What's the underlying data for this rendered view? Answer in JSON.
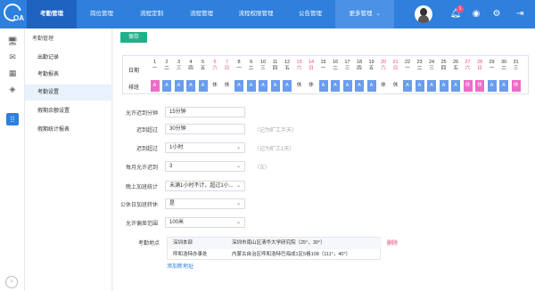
{
  "brand": {
    "logo_text": "OA"
  },
  "nav": {
    "items": [
      "考勤管理",
      "岗位管理",
      "流程定制",
      "流程管理",
      "流程权限管理",
      "公告管理"
    ],
    "more_label": "更多管理"
  },
  "topbar": {
    "notification_count": "1"
  },
  "sidebar": {
    "title": "考勤管理",
    "items": [
      "出勤记录",
      "考勤报表",
      "考勤设置",
      "假期余额设置",
      "假期统计报表"
    ]
  },
  "toolbar": {
    "save_label": "保存"
  },
  "calendar": {
    "date_label": "日期",
    "shift_label": "排班",
    "days": [
      {
        "n": "1",
        "w": "一",
        "s": "A",
        "we": false,
        "pink": true
      },
      {
        "n": "2",
        "w": "二",
        "s": "A",
        "we": false
      },
      {
        "n": "3",
        "w": "三",
        "s": "A",
        "we": false
      },
      {
        "n": "4",
        "w": "四",
        "s": "A",
        "we": false
      },
      {
        "n": "5",
        "w": "五",
        "s": "A",
        "we": false
      },
      {
        "n": "6",
        "w": "六",
        "s": "休",
        "we": true,
        "rest": true
      },
      {
        "n": "7",
        "w": "日",
        "s": "休",
        "we": true,
        "rest": true
      },
      {
        "n": "8",
        "w": "一",
        "s": "A",
        "we": false
      },
      {
        "n": "9",
        "w": "二",
        "s": "A",
        "we": false
      },
      {
        "n": "10",
        "w": "三",
        "s": "A",
        "we": false
      },
      {
        "n": "11",
        "w": "四",
        "s": "A",
        "we": false
      },
      {
        "n": "12",
        "w": "五",
        "s": "A",
        "we": false
      },
      {
        "n": "13",
        "w": "六",
        "s": "休",
        "we": true,
        "rest": true
      },
      {
        "n": "14",
        "w": "日",
        "s": "休",
        "we": true,
        "rest": true
      },
      {
        "n": "15",
        "w": "一",
        "s": "A",
        "we": false
      },
      {
        "n": "16",
        "w": "二",
        "s": "A",
        "we": false
      },
      {
        "n": "17",
        "w": "三",
        "s": "A",
        "we": false
      },
      {
        "n": "18",
        "w": "四",
        "s": "A",
        "we": false
      },
      {
        "n": "19",
        "w": "五",
        "s": "A",
        "we": false
      },
      {
        "n": "20",
        "w": "六",
        "s": "休",
        "we": true,
        "rest": true
      },
      {
        "n": "21",
        "w": "日",
        "s": "休",
        "we": true,
        "rest": true
      },
      {
        "n": "22",
        "w": "一",
        "s": "A",
        "we": false
      },
      {
        "n": "23",
        "w": "二",
        "s": "A",
        "we": false
      },
      {
        "n": "24",
        "w": "三",
        "s": "A",
        "we": false
      },
      {
        "n": "25",
        "w": "四",
        "s": "A",
        "we": false
      },
      {
        "n": "26",
        "w": "五",
        "s": "A",
        "we": false
      },
      {
        "n": "27",
        "w": "六",
        "s": "休",
        "we": true,
        "pink": true
      },
      {
        "n": "28",
        "w": "日",
        "s": "休",
        "we": true,
        "pink": true
      },
      {
        "n": "29",
        "w": "一",
        "s": "A",
        "we": false
      },
      {
        "n": "30",
        "w": "二",
        "s": "A",
        "we": false
      },
      {
        "n": "31",
        "w": "三",
        "s": "休",
        "we": false,
        "pink": true
      }
    ]
  },
  "form": {
    "rows": [
      {
        "label": "允许迟到分钟",
        "value": "15分钟",
        "hint": "",
        "select": false
      },
      {
        "label": "迟到超过",
        "value": "30分钟",
        "hint": "（记为旷工半天）",
        "select": false
      },
      {
        "label": "迟到超过",
        "value": "1小时",
        "hint": "（记为旷工1天）",
        "select": true
      },
      {
        "label": "每月允许迟到",
        "value": "3",
        "hint": "（次）",
        "select": true
      },
      {
        "label": "晚上加班统计",
        "value": "未满1小时不计，超过1小...",
        "hint": "",
        "select": true
      },
      {
        "label": "公休日加班转休",
        "value": "是",
        "hint": "",
        "select": true
      },
      {
        "label": "允许偏差范围",
        "value": "100米",
        "hint": "",
        "select": true
      }
    ],
    "locations_label": "考勤地点",
    "locations": [
      {
        "name": "深圳本部",
        "address": "深圳市南山区清华大学研究院（25°，30°）"
      },
      {
        "name": "呼和浩特办事处",
        "address": "内蒙古自治区呼和浩特巴海成1区5格108（111°，40°）"
      }
    ],
    "delete_label": "删除",
    "add_label": "添加新地址"
  }
}
